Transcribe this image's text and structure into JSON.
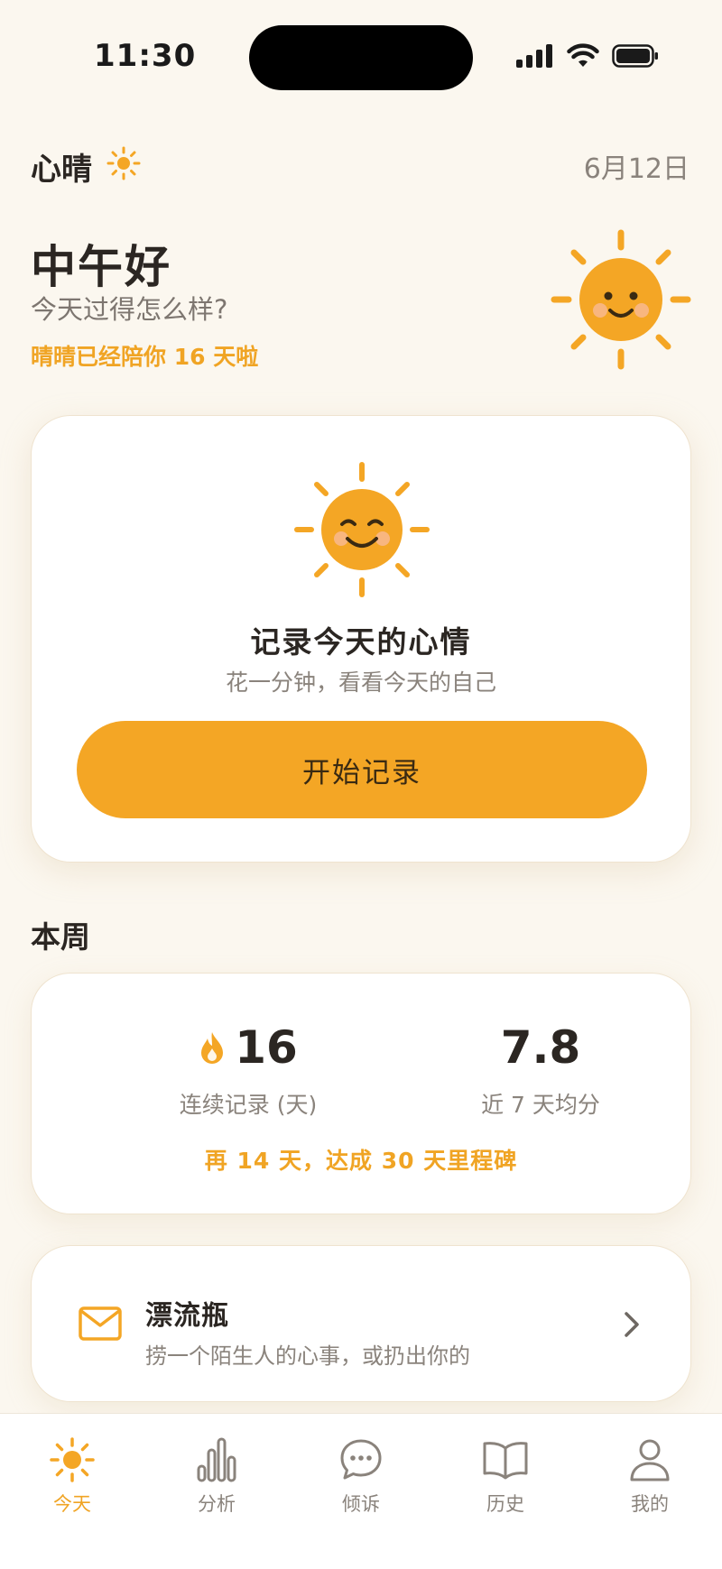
{
  "status_bar": {
    "time": "11:30"
  },
  "header": {
    "app_title": "心晴",
    "date": "6月12日"
  },
  "greeting": {
    "title": "中午好",
    "subtitle": "今天过得怎么样?",
    "companion_text": "晴晴已经陪你 16 天啦"
  },
  "record_card": {
    "title": "记录今天的心情",
    "subtitle": "花一分钟，看看今天的自己",
    "button_label": "开始记录"
  },
  "week": {
    "section_title": "本周",
    "streak_value": "16",
    "streak_label": "连续记录 (天)",
    "average_value": "7.8",
    "average_label": "近 7 天均分",
    "milestone_text": "再 14 天，达成 30 天里程碑"
  },
  "drift_bottle": {
    "title": "漂流瓶",
    "subtitle": "捞一个陌生人的心事，或扔出你的"
  },
  "tabs": [
    {
      "label": "今天",
      "icon": "sun-icon",
      "active": true
    },
    {
      "label": "分析",
      "icon": "bar-chart-icon",
      "active": false
    },
    {
      "label": "倾诉",
      "icon": "chat-bubble-icon",
      "active": false
    },
    {
      "label": "历史",
      "icon": "book-icon",
      "active": false
    },
    {
      "label": "我的",
      "icon": "person-icon",
      "active": false
    }
  ],
  "colors": {
    "accent": "#F4A625",
    "accent_text": "#F0A424",
    "background": "#FBF7EF",
    "card": "#FFFFFF",
    "text_primary": "#2B2622",
    "text_secondary": "#8A837C"
  }
}
